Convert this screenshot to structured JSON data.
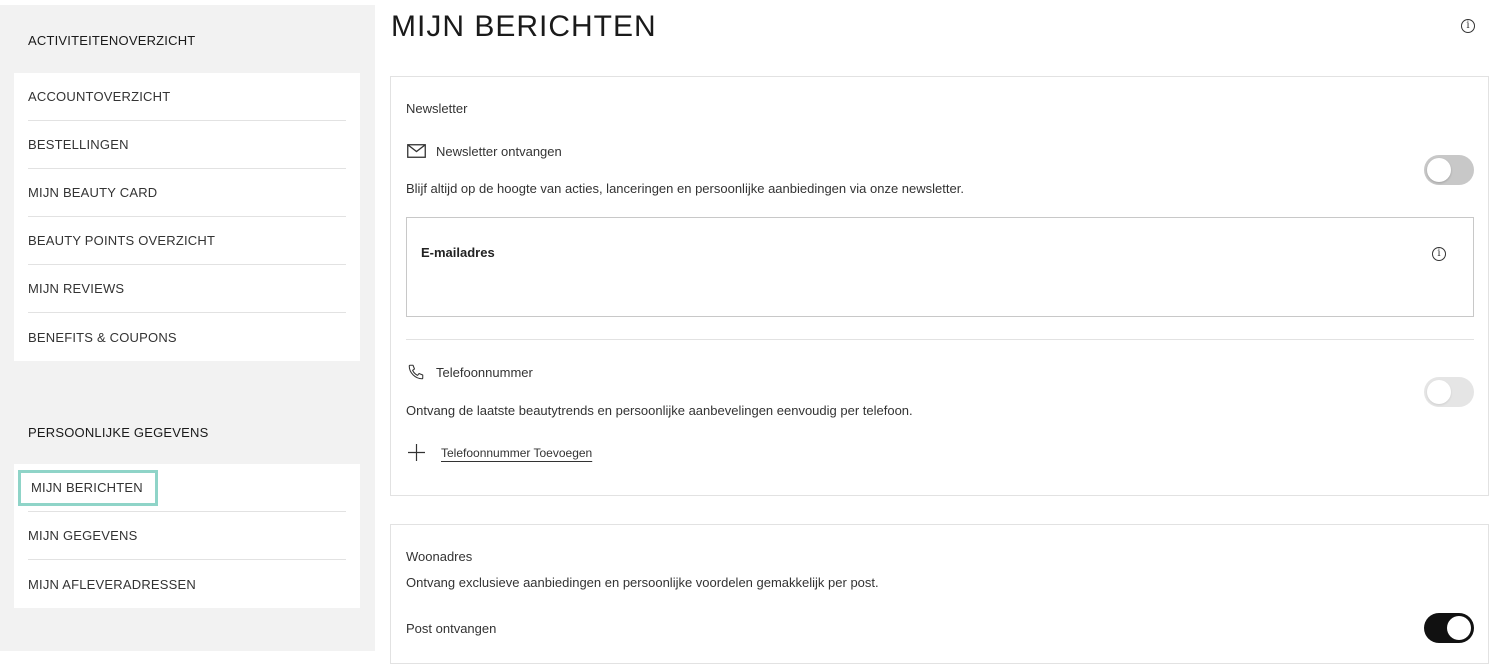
{
  "sidebar": {
    "section1_heading": "ACTIVITEITENOVERZICHT",
    "section1_items": [
      {
        "label": "ACCOUNTOVERZICHT"
      },
      {
        "label": "BESTELLINGEN"
      },
      {
        "label": "MIJN BEAUTY CARD"
      },
      {
        "label": "BEAUTY POINTS OVERZICHT"
      },
      {
        "label": "MIJN REVIEWS"
      },
      {
        "label": "BENEFITS & COUPONS"
      }
    ],
    "section2_heading": "PERSOONLIJKE GEGEVENS",
    "section2_items": [
      {
        "label": "MIJN BERICHTEN",
        "active": true
      },
      {
        "label": "MIJN GEGEVENS"
      },
      {
        "label": "MIJN AFLEVERADRESSEN"
      }
    ]
  },
  "main": {
    "title": "MIJN BERICHTEN",
    "newsletter_card": {
      "heading": "Newsletter",
      "newsletter_label": "Newsletter ontvangen",
      "newsletter_desc": "Blijf altijd op de hoogte van acties, lanceringen en persoonlijke aanbiedingen via onze newsletter.",
      "newsletter_enabled": false,
      "email_label": "E-mailadres",
      "phone_label": "Telefoonnummer",
      "phone_desc": "Ontvang de laatste beautytrends en persoonlijke aanbevelingen eenvoudig per telefoon.",
      "phone_enabled": false,
      "add_phone_label": "Telefoonnummer Toevoegen"
    },
    "address_card": {
      "heading": "Woonadres",
      "desc": "Ontvang exclusieve aanbiedingen en persoonlijke voordelen gemakkelijk per post.",
      "post_label": "Post ontvangen",
      "post_enabled": true
    }
  },
  "colors": {
    "sidebar_bg": "#f2f2f2",
    "active_outline": "#8fd4c8",
    "toggle_on": "#111111",
    "toggle_off": "#c8c8c8"
  }
}
